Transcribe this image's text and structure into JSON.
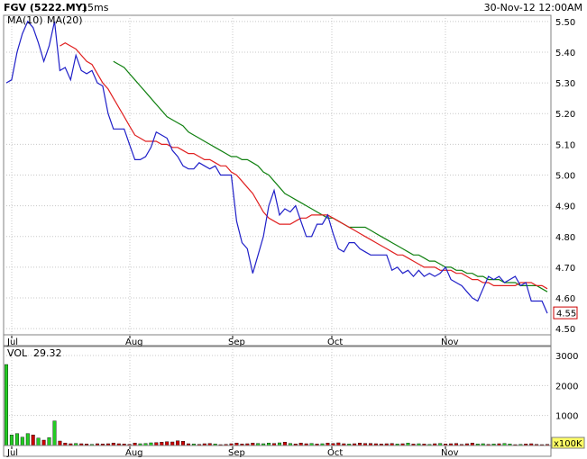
{
  "header": {
    "symbol": "FGV (5222.MY)",
    "interval": "15ms",
    "timestamp": "30-Nov-12 12:00AM"
  },
  "legend": {
    "ma10": "MA(10)",
    "ma20": "MA(20)",
    "vol_label": "VOL",
    "vol_value": "29.32",
    "vol_unit": "x100K"
  },
  "colors": {
    "price": "#1f1fc8",
    "ma10": "#e02020",
    "ma20": "#108010",
    "vol_up": "#22cc22",
    "vol_down": "#cc0000",
    "last_price_box": "#cc0000"
  },
  "chart_data": [
    {
      "type": "line",
      "title": "FGV (5222.MY)",
      "x_labels": [
        "Jul",
        "Aug",
        "Sep",
        "Oct",
        "Nov"
      ],
      "y_ticks": [
        "5.50",
        "5.40",
        "5.30",
        "5.20",
        "5.10",
        "5.00",
        "4.90",
        "4.80",
        "4.70",
        "4.60",
        "4.50"
      ],
      "ylim": [
        4.48,
        5.52
      ],
      "last_value": "4.55",
      "series": [
        {
          "name": "",
          "values": [
            5.3,
            5.31,
            5.4,
            5.46,
            5.5,
            5.48,
            5.43,
            5.37,
            5.42,
            5.5,
            5.34,
            5.35,
            5.31,
            5.39,
            5.34,
            5.33,
            5.34,
            5.3,
            5.29,
            5.2,
            5.15,
            5.15,
            5.15,
            5.1,
            5.05,
            5.05,
            5.06,
            5.09,
            5.14,
            5.13,
            5.12,
            5.08,
            5.06,
            5.03,
            5.02,
            5.02,
            5.04,
            5.03,
            5.02,
            5.03,
            5.0,
            5.0,
            5.0,
            4.85,
            4.78,
            4.76,
            4.68,
            4.74,
            4.8,
            4.9,
            4.95,
            4.87,
            4.89,
            4.88,
            4.9,
            4.85,
            4.8,
            4.8,
            4.84,
            4.84,
            4.87,
            4.81,
            4.76,
            4.75,
            4.78,
            4.78,
            4.76,
            4.75,
            4.74,
            4.74,
            4.74,
            4.74,
            4.69,
            4.7,
            4.68,
            4.69,
            4.67,
            4.69,
            4.67,
            4.68,
            4.67,
            4.68,
            4.7,
            4.66,
            4.65,
            4.64,
            4.62,
            4.6,
            4.59,
            4.63,
            4.67,
            4.66,
            4.67,
            4.65,
            4.66,
            4.67,
            4.64,
            4.65,
            4.59,
            4.59,
            4.59,
            4.55
          ]
        },
        {
          "name": "MA(10)",
          "values": [
            null,
            null,
            null,
            null,
            null,
            null,
            null,
            null,
            null,
            null,
            5.42,
            5.43,
            5.42,
            5.41,
            5.39,
            5.37,
            5.36,
            5.33,
            5.3,
            5.28,
            5.25,
            5.22,
            5.19,
            5.16,
            5.13,
            5.12,
            5.11,
            5.11,
            5.11,
            5.1,
            5.1,
            5.09,
            5.09,
            5.08,
            5.07,
            5.07,
            5.06,
            5.05,
            5.05,
            5.04,
            5.03,
            5.03,
            5.01,
            5.0,
            4.98,
            4.96,
            4.94,
            4.91,
            4.88,
            4.86,
            4.85,
            4.84,
            4.84,
            4.84,
            4.85,
            4.86,
            4.86,
            4.87,
            4.87,
            4.87,
            4.87,
            4.86,
            4.85,
            4.84,
            4.83,
            4.82,
            4.81,
            4.8,
            4.79,
            4.78,
            4.77,
            4.76,
            4.75,
            4.74,
            4.74,
            4.73,
            4.72,
            4.71,
            4.7,
            4.7,
            4.7,
            4.69,
            4.69,
            4.69,
            4.68,
            4.68,
            4.67,
            4.66,
            4.66,
            4.65,
            4.65,
            4.64,
            4.64,
            4.64,
            4.64,
            4.64,
            4.65,
            4.65,
            4.65,
            4.64,
            4.64,
            4.63
          ]
        },
        {
          "name": "MA(20)",
          "values": [
            null,
            null,
            null,
            null,
            null,
            null,
            null,
            null,
            null,
            null,
            null,
            null,
            null,
            null,
            null,
            null,
            null,
            null,
            null,
            null,
            5.37,
            5.36,
            5.35,
            5.33,
            5.31,
            5.29,
            5.27,
            5.25,
            5.23,
            5.21,
            5.19,
            5.18,
            5.17,
            5.16,
            5.14,
            5.13,
            5.12,
            5.11,
            5.1,
            5.09,
            5.08,
            5.07,
            5.06,
            5.06,
            5.05,
            5.05,
            5.04,
            5.03,
            5.01,
            5.0,
            4.98,
            4.96,
            4.94,
            4.93,
            4.92,
            4.91,
            4.9,
            4.89,
            4.88,
            4.87,
            4.86,
            4.86,
            4.85,
            4.84,
            4.83,
            4.83,
            4.83,
            4.83,
            4.82,
            4.81,
            4.8,
            4.79,
            4.78,
            4.77,
            4.76,
            4.75,
            4.74,
            4.74,
            4.73,
            4.72,
            4.72,
            4.71,
            4.7,
            4.7,
            4.69,
            4.69,
            4.68,
            4.68,
            4.67,
            4.67,
            4.66,
            4.66,
            4.66,
            4.65,
            4.65,
            4.65,
            4.64,
            4.64,
            4.64,
            4.64,
            4.63,
            4.62
          ]
        }
      ]
    },
    {
      "type": "bar",
      "title": "VOL",
      "x_labels": [
        "Jul",
        "Aug",
        "Sep",
        "Oct",
        "Nov"
      ],
      "y_ticks": [
        "3000",
        "2000",
        "1000"
      ],
      "ylim": [
        0,
        3300
      ],
      "unit": "x100K",
      "series": [
        {
          "name": "VOL",
          "values": [
            2700,
            350,
            400,
            280,
            400,
            350,
            250,
            180,
            260,
            820,
            150,
            80,
            60,
            70,
            60,
            50,
            40,
            60,
            50,
            60,
            80,
            60,
            50,
            40,
            80,
            60,
            70,
            90,
            100,
            110,
            130,
            120,
            160,
            140,
            60,
            50,
            40,
            60,
            70,
            50,
            30,
            40,
            60,
            80,
            50,
            60,
            80,
            70,
            60,
            80,
            70,
            90,
            110,
            70,
            50,
            80,
            60,
            70,
            50,
            60,
            80,
            70,
            90,
            60,
            50,
            60,
            80,
            70,
            70,
            60,
            50,
            60,
            70,
            50,
            60,
            80,
            50,
            60,
            50,
            40,
            60,
            70,
            50,
            60,
            70,
            40,
            60,
            80,
            50,
            60,
            40,
            50,
            60,
            70,
            50,
            30,
            40,
            50,
            60,
            40,
            30,
            40
          ],
          "up": [
            1,
            1,
            1,
            1,
            1,
            0,
            1,
            0,
            1,
            1,
            0,
            0,
            0,
            1,
            0,
            0,
            1,
            0,
            0,
            0,
            0,
            0,
            0,
            0,
            0,
            1,
            1,
            1,
            0,
            0,
            0,
            0,
            0,
            0,
            0,
            1,
            0,
            0,
            0,
            1,
            0,
            0,
            0,
            0,
            0,
            0,
            0,
            1,
            1,
            1,
            0,
            1,
            0,
            1,
            0,
            0,
            0,
            1,
            0,
            1,
            0,
            0,
            0,
            0,
            1,
            0,
            0,
            0,
            0,
            0,
            0,
            0,
            0,
            1,
            0,
            1,
            0,
            1,
            0,
            1,
            0,
            1,
            0,
            0,
            0,
            0,
            0,
            0,
            1,
            1,
            0,
            1,
            0,
            1,
            1,
            0,
            1,
            0,
            0,
            0,
            0,
            0
          ]
        }
      ]
    }
  ]
}
